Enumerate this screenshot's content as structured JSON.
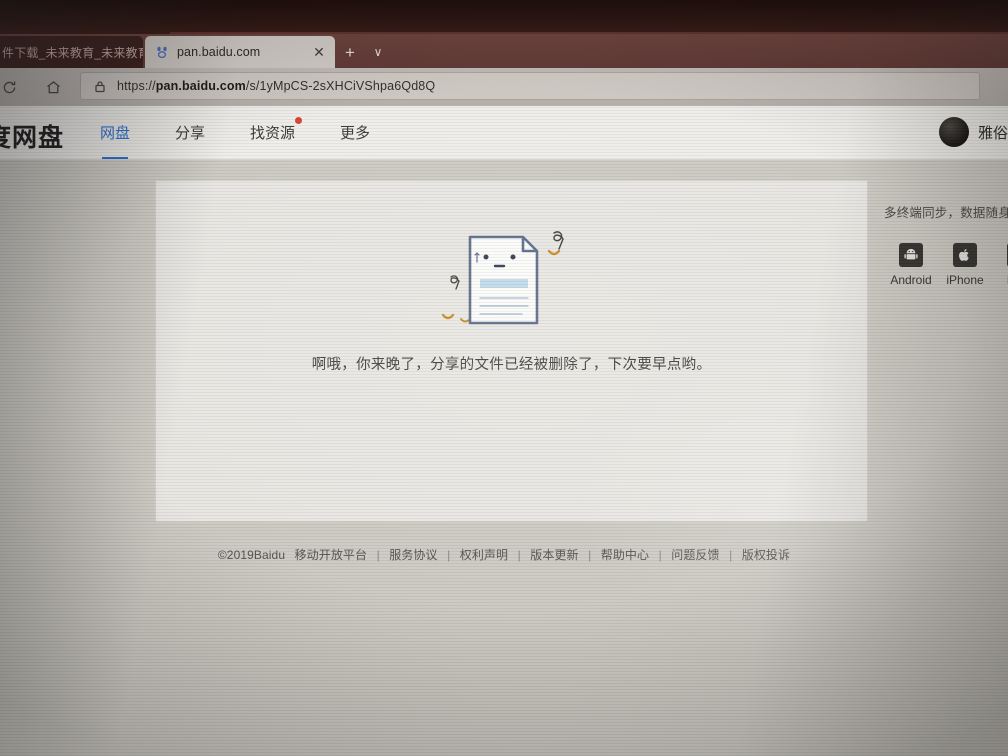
{
  "browser": {
    "inactive_tab_title": "件下载_未来教育_未来教育",
    "active_tab_title": "pan.baidu.com",
    "favicon": "baidu-paw-icon",
    "close_tab_glyph": "✕",
    "new_tab_glyph": "+",
    "tab_menu_glyph": "∨",
    "refresh_glyph": "↻",
    "home_glyph": "⌂",
    "lock_glyph": "🔒",
    "url_prefix": "https://",
    "url_domain": "pan.baidu.com",
    "url_path": "/s/1yMpCS-2sXHCiVShpa6Qd8Q"
  },
  "site": {
    "logo": "度网盘",
    "nav": [
      {
        "label": "网盘",
        "active": true,
        "badge": false
      },
      {
        "label": "分享",
        "active": false,
        "badge": false
      },
      {
        "label": "找资源",
        "active": false,
        "badge": true
      },
      {
        "label": "更多",
        "active": false,
        "badge": false
      }
    ],
    "user_name": "雅俗赏共",
    "accent_color": "#2b6fd1",
    "badge_color": "#d94436"
  },
  "content": {
    "error_message": "啊哦，你来晚了，分享的文件已经被删除了，下次要早点哟。",
    "illustration": "deleted-file-doc-illustration"
  },
  "promo": {
    "title": "多终端同步，数据随身",
    "devices": [
      {
        "label": "Android",
        "icon": "android-icon",
        "glyph": "🤖"
      },
      {
        "label": "iPhone",
        "icon": "apple-iphone-icon",
        "glyph": ""
      },
      {
        "label": "iPad",
        "icon": "apple-ipad-icon",
        "glyph": "▢"
      }
    ]
  },
  "footer": {
    "copyright": "©2019Baidu",
    "links": [
      "移动开放平台",
      "服务协议",
      "权利声明",
      "版本更新",
      "帮助中心",
      "问题反馈",
      "版权投诉"
    ],
    "separator": "|"
  }
}
